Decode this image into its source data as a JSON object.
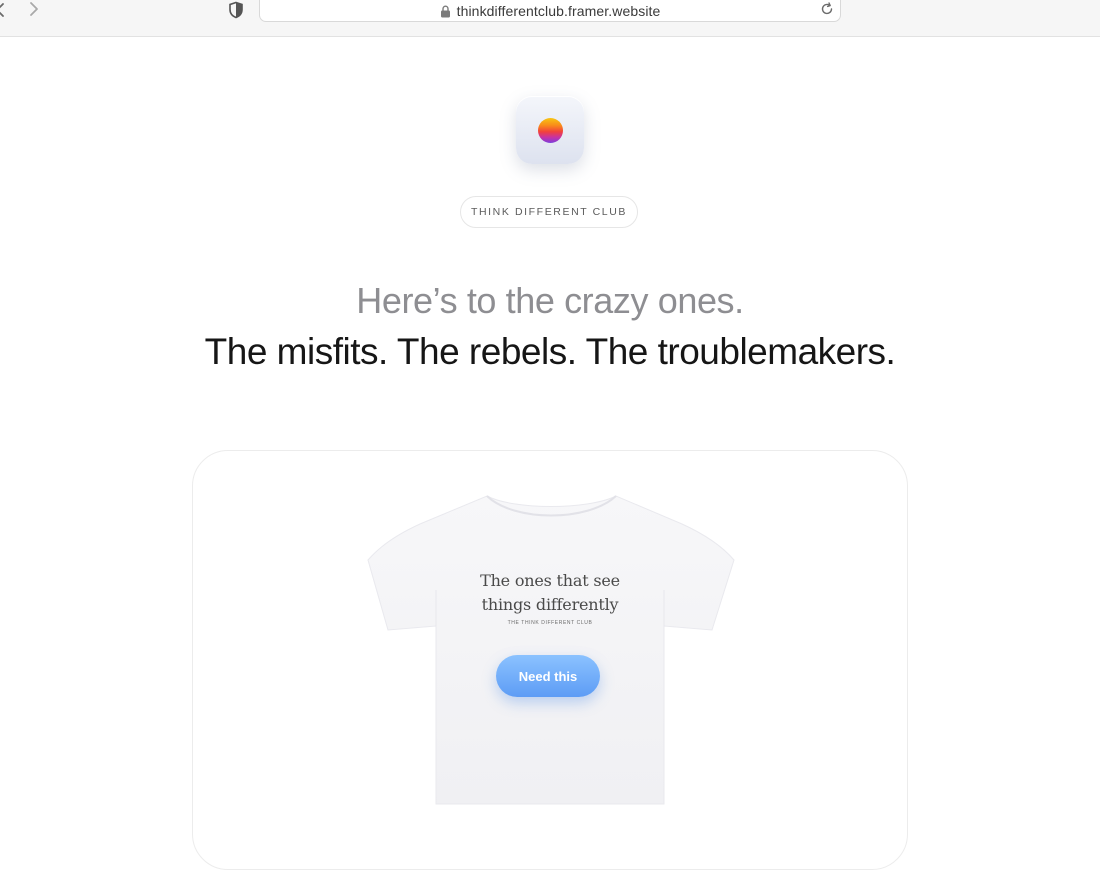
{
  "browser": {
    "url": "thinkdifferentclub.framer.website"
  },
  "hero": {
    "badge": "THINK DIFFERENT CLUB",
    "headline_muted": "Here’s to the crazy ones.",
    "headline_strong": "The misfits. The rebels. The troublemakers."
  },
  "product": {
    "shirt_line_1": "The ones that see",
    "shirt_line_2": "things differently",
    "shirt_small_text": "THE THINK DIFFERENT CLUB",
    "cta_label": "Need this"
  },
  "colors": {
    "headline_muted": "#8e8e92",
    "headline_strong": "#161616",
    "cta": "#5d9cf5",
    "logo_gradient": [
      "#f7c513",
      "#f98b1a",
      "#f2413c",
      "#c631a6",
      "#7b3fdc"
    ]
  },
  "icons": {
    "back": "chevron-left-icon",
    "forward": "chevron-right-icon",
    "privacy": "shield-icon",
    "secure": "lock-icon",
    "reload": "reload-icon"
  }
}
